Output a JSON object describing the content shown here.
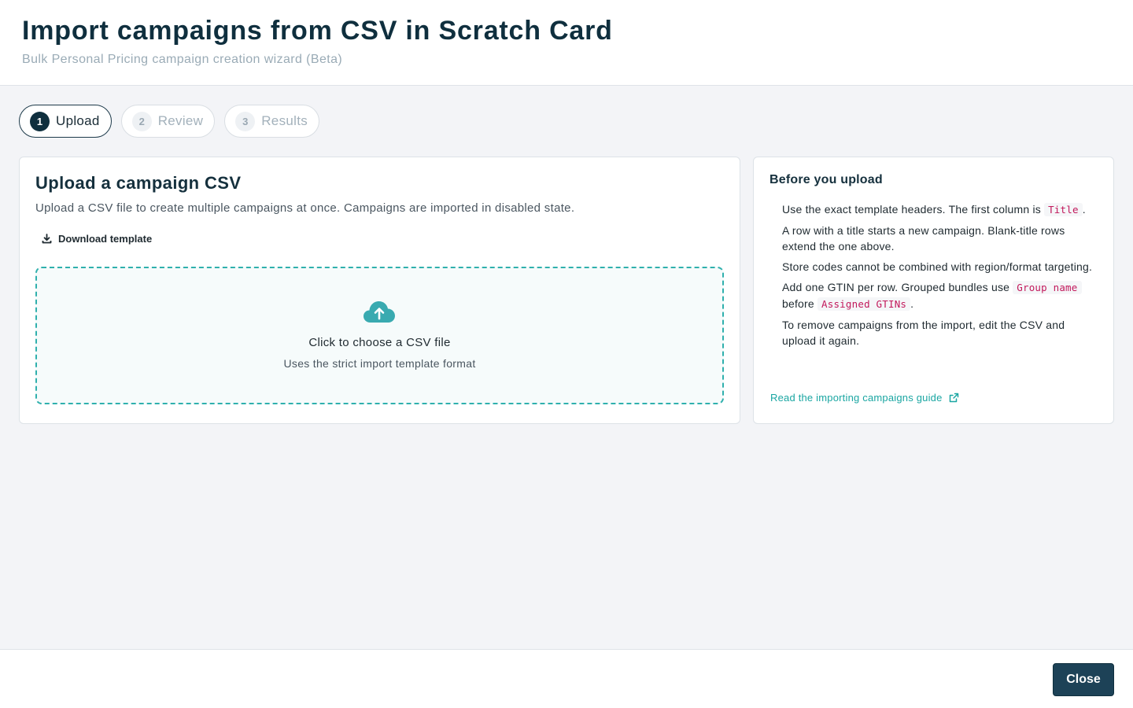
{
  "header": {
    "title": "Import campaigns from CSV in Scratch Card",
    "subtitle": "Bulk Personal Pricing campaign creation wizard (Beta)"
  },
  "steps": [
    {
      "number": "1",
      "label": "Upload",
      "active": true
    },
    {
      "number": "2",
      "label": "Review",
      "active": false
    },
    {
      "number": "3",
      "label": "Results",
      "active": false
    }
  ],
  "upload": {
    "title": "Upload a campaign CSV",
    "description": "Upload a CSV file to create multiple campaigns at once. Campaigns are imported in disabled state.",
    "download_label": "Download template",
    "dropzone_title": "Click to choose a CSV file",
    "dropzone_subtitle": "Uses the strict import template format"
  },
  "side": {
    "title": "Before you upload",
    "tips": {
      "t1": "Use the exact template headers. The first column is",
      "t1_code": "Title",
      "t2": "A row with a title starts a new campaign. Blank-title rows extend the one above.",
      "t3": "Store codes cannot be combined with region/format targeting.",
      "t4a": "Add one GTIN per row. Grouped bundles use",
      "t4_code1": "Group name",
      "t4b": "before",
      "t4_code2": "Assigned GTINs",
      "t5": "To remove campaigns from the import, edit the CSV and upload it again."
    },
    "guide_link": "Read the importing campaigns guide"
  },
  "footer": {
    "close_label": "Close"
  },
  "colors": {
    "primary_dark": "#0f2f3e",
    "accent_teal": "#2fb0ad",
    "code_pink": "#c2185b"
  }
}
